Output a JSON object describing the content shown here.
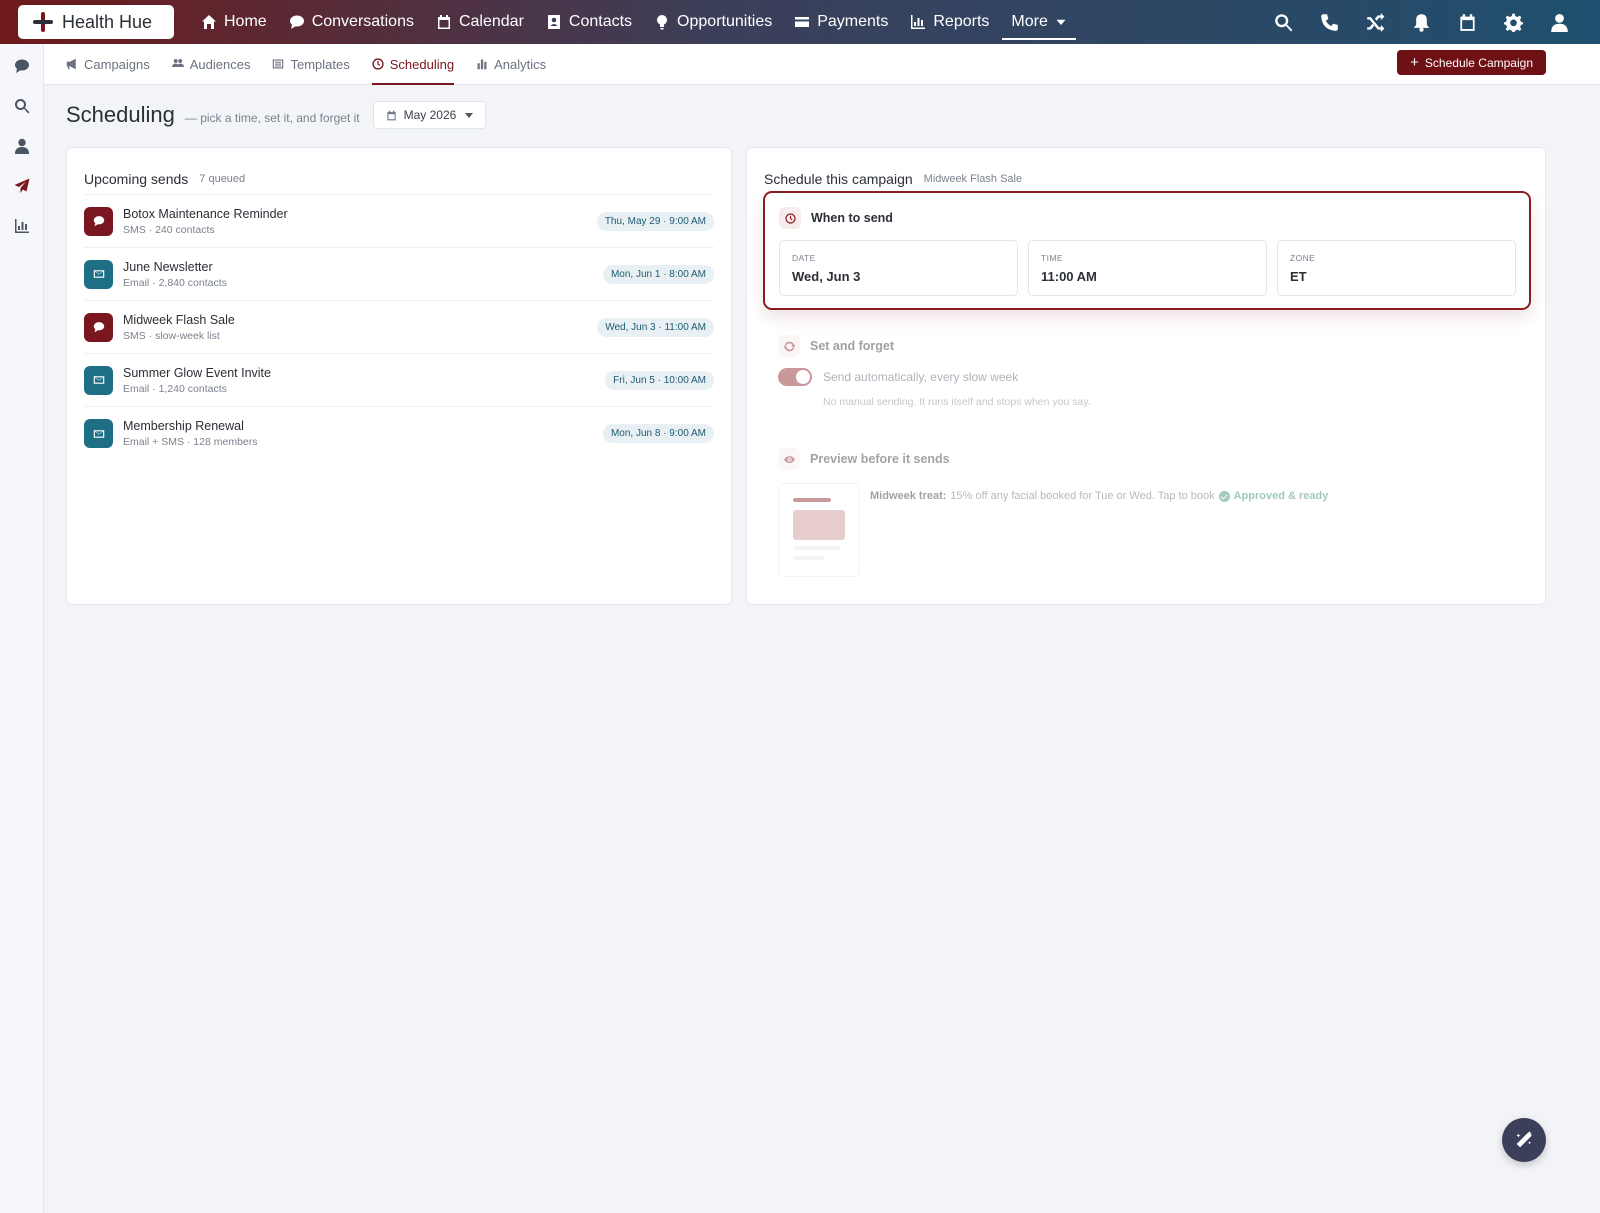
{
  "brand": {
    "name": "Health Hue"
  },
  "nav": {
    "items": [
      {
        "label": "Home",
        "icon": "home-icon"
      },
      {
        "label": "Conversations",
        "icon": "chat-icon"
      },
      {
        "label": "Calendar",
        "icon": "calendar-icon"
      },
      {
        "label": "Contacts",
        "icon": "contact-card-icon"
      },
      {
        "label": "Opportunities",
        "icon": "lightbulb-icon"
      },
      {
        "label": "Payments",
        "icon": "credit-card-icon"
      },
      {
        "label": "Reports",
        "icon": "bar-chart-icon"
      }
    ],
    "more_label": "More",
    "right_icons": [
      "search-icon",
      "phone-icon",
      "shuffle-icon",
      "bell-icon",
      "calendar-icon",
      "gear-icon",
      "user-icon"
    ]
  },
  "rail": {
    "icons": [
      "chat-icon",
      "search-icon",
      "user-icon",
      "send-icon",
      "bar-chart-icon"
    ],
    "active_index": 3
  },
  "subnav": {
    "tabs": [
      {
        "label": "Campaigns",
        "icon": "megaphone-icon"
      },
      {
        "label": "Audiences",
        "icon": "users-icon"
      },
      {
        "label": "Templates",
        "icon": "list-icon"
      },
      {
        "label": "Scheduling",
        "icon": "clock-icon"
      },
      {
        "label": "Analytics",
        "icon": "bar-chart-icon"
      }
    ],
    "active_tab": "Scheduling",
    "action_label": "Schedule Campaign"
  },
  "page": {
    "title": "Scheduling",
    "subtitle": "— pick a time, set it, and forget it",
    "month": "May 2026"
  },
  "upcoming": {
    "title": "Upcoming sends",
    "count_label": "7 queued",
    "items": [
      {
        "name": "Botox Maintenance Reminder",
        "detail": "SMS · 240 contacts",
        "date": "Thu, May 29 · 9:00 AM",
        "channel": "sms"
      },
      {
        "name": "June Newsletter",
        "detail": "Email · 2,840 contacts",
        "date": "Mon, Jun 1 · 8:00 AM",
        "channel": "email"
      },
      {
        "name": "Midweek Flash Sale",
        "detail": "SMS · slow-week list",
        "date": "Wed, Jun 3 · 11:00 AM",
        "channel": "sms"
      },
      {
        "name": "Summer Glow Event Invite",
        "detail": "Email · 1,240 contacts",
        "date": "Fri, Jun 5 · 10:00 AM",
        "channel": "email"
      },
      {
        "name": "Membership Renewal",
        "detail": "Email + SMS · 128 members",
        "date": "Mon, Jun 8 · 9:00 AM",
        "channel": "email"
      }
    ]
  },
  "schedule": {
    "title": "Schedule this campaign",
    "campaign_name": "Midweek Flash Sale",
    "when": {
      "title": "When to send",
      "date_label": "DATE",
      "date_value": "Wed, Jun 3",
      "time_label": "TIME",
      "time_value": "11:00 AM",
      "zone_label": "ZONE",
      "zone_value": "ET"
    },
    "forget": {
      "title": "Set and forget",
      "toggle_label": "Send automatically, every slow week",
      "toggle_on": true,
      "note": "No manual sending. It runs itself and stops when you say."
    },
    "preview": {
      "title": "Preview before it sends",
      "lead": "Midweek treat:",
      "message": "15% off any facial booked for Tue or Wed. Tap to book",
      "status": "Approved & ready"
    }
  },
  "colors": {
    "brand": "#7a1620",
    "email": "#1e6f86",
    "approved": "#2e8a5c"
  }
}
